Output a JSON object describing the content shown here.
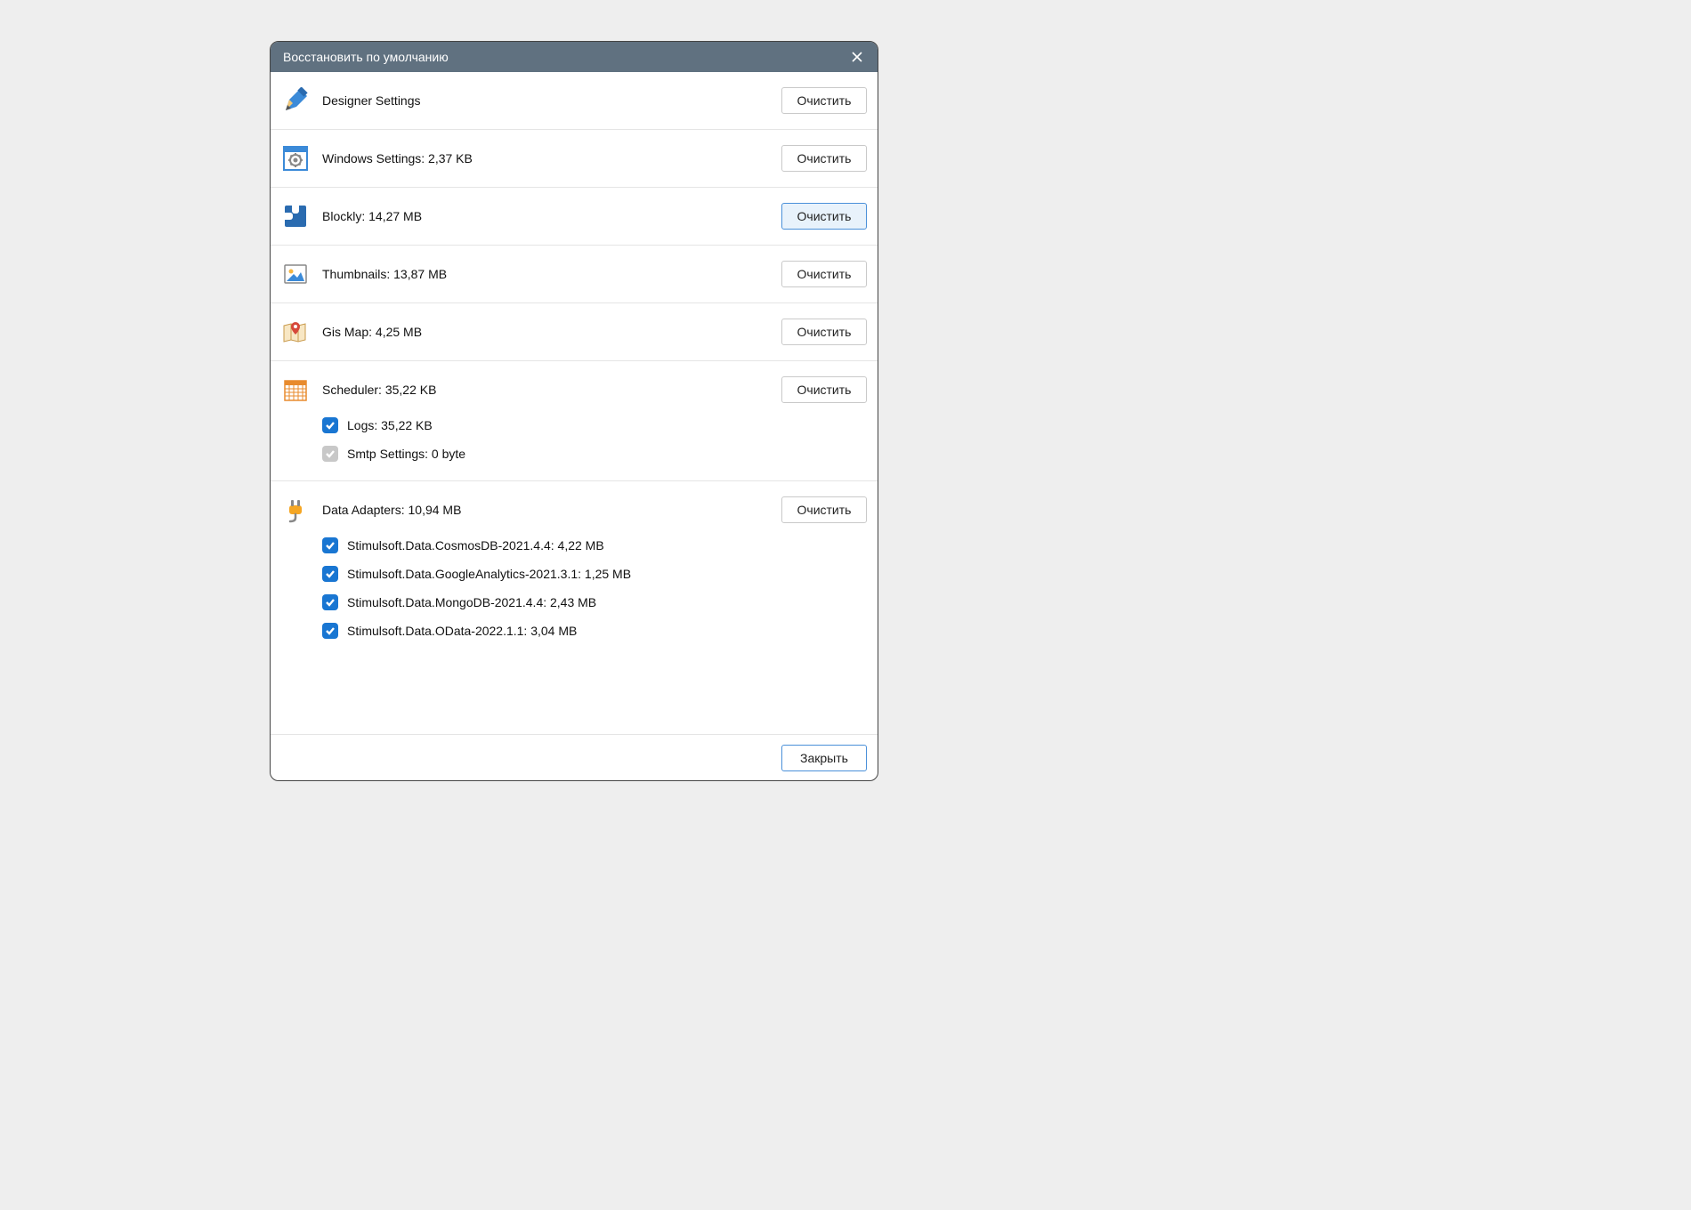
{
  "dialog": {
    "title": "Восстановить по умолчанию",
    "clear_label": "Очистить",
    "close_label": "Закрыть"
  },
  "rows": {
    "designer": {
      "label": "Designer Settings"
    },
    "windows": {
      "label": "Windows Settings: 2,37 KB"
    },
    "blockly": {
      "label": "Blockly: 14,27 MB"
    },
    "thumbnails": {
      "label": "Thumbnails: 13,87 MB"
    },
    "gismap": {
      "label": "Gis Map: 4,25 MB"
    },
    "scheduler": {
      "label": "Scheduler: 35,22 KB",
      "logs": "Logs: 35,22 KB",
      "smtp": "Smtp Settings: 0 byte"
    },
    "adapters": {
      "label": "Data Adapters: 10,94 MB",
      "items": [
        "Stimulsoft.Data.CosmosDB-2021.4.4: 4,22 MB",
        "Stimulsoft.Data.GoogleAnalytics-2021.3.1: 1,25 MB",
        "Stimulsoft.Data.MongoDB-2021.4.4: 2,43 MB",
        "Stimulsoft.Data.OData-2022.1.1: 3,04 MB"
      ]
    }
  }
}
